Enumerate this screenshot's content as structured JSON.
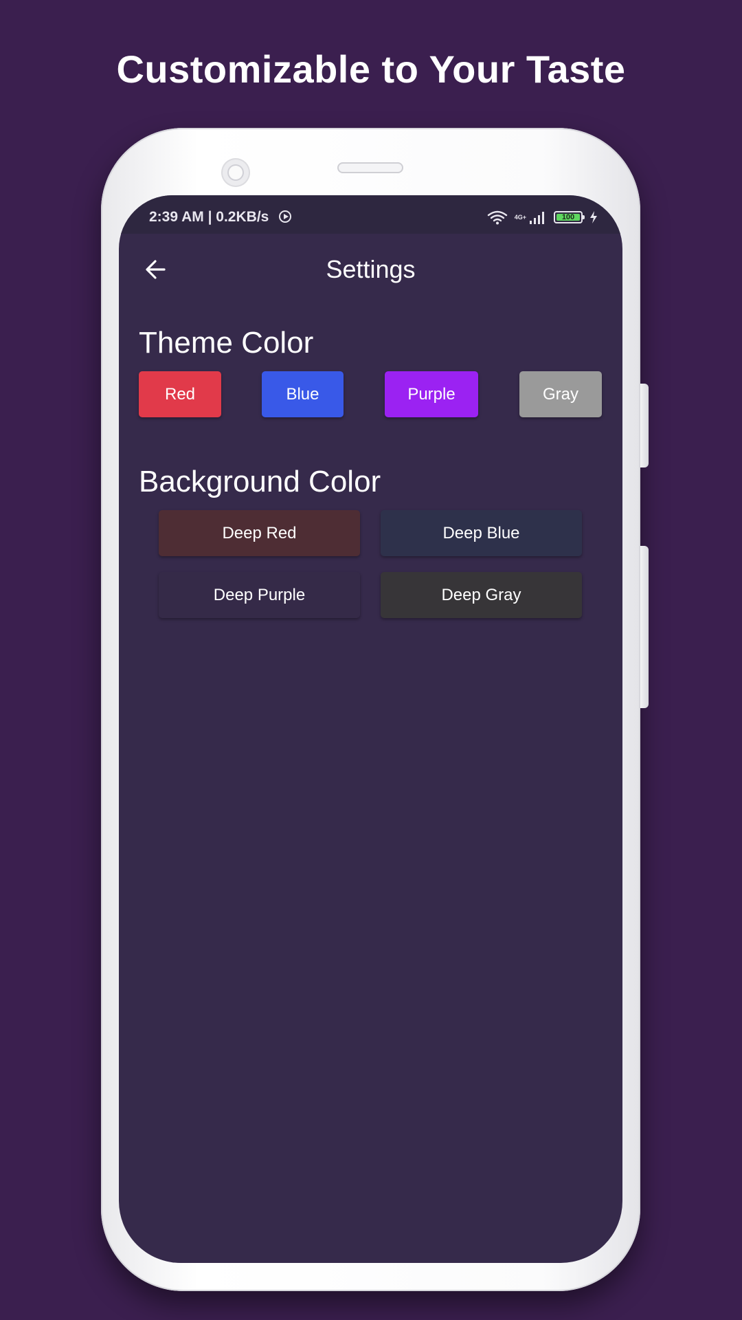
{
  "headline": "Customizable to Your Taste",
  "status_bar": {
    "time_speed": "2:39 AM | 0.2KB/s",
    "network_label": "4G+",
    "battery_level": "100"
  },
  "app_bar": {
    "title": "Settings"
  },
  "theme_section": {
    "title": "Theme Color",
    "options": [
      {
        "label": "Red",
        "color": "#e13a4a"
      },
      {
        "label": "Blue",
        "color": "#3959e8"
      },
      {
        "label": "Purple",
        "color": "#9b22f2"
      },
      {
        "label": "Gray",
        "color": "#9a9a9a"
      }
    ]
  },
  "background_section": {
    "title": "Background Color",
    "options": [
      {
        "label": "Deep Red",
        "color": "#4e2d34"
      },
      {
        "label": "Deep Blue",
        "color": "#2e314b"
      },
      {
        "label": "Deep Purple",
        "color": "#352a48"
      },
      {
        "label": "Deep Gray",
        "color": "#373538"
      }
    ]
  },
  "colors": {
    "page_background": "#3b1f4f",
    "screen_background": "#362a4b",
    "status_bar": "#2e2740",
    "text": "#ffffff"
  }
}
